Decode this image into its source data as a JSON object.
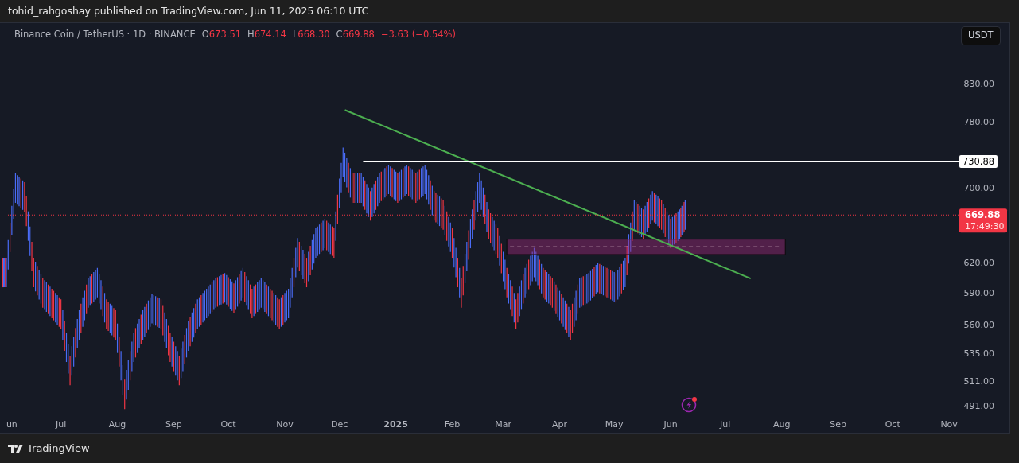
{
  "header": {
    "text": "tohid_rahgoshay published on TradingView.com, Jun 11, 2025 06:10 UTC"
  },
  "legend": {
    "symbol": "Binance Coin / TetherUS · 1D · BINANCE",
    "ohlc": [
      {
        "key": "O",
        "value": "673.51"
      },
      {
        "key": "H",
        "value": "674.14"
      },
      {
        "key": "L",
        "value": "668.30"
      },
      {
        "key": "C",
        "value": "669.88"
      }
    ],
    "change": "−3.63 (−0.54%)"
  },
  "currency_button": "USDT",
  "chart": {
    "price_axis": [
      "830.00",
      "780.00",
      "700.00",
      "620.00",
      "590.00",
      "560.00",
      "535.00",
      "511.00",
      "491.00"
    ],
    "time_axis": [
      {
        "label": "un",
        "kind": "month"
      },
      {
        "label": "Jul",
        "kind": "month"
      },
      {
        "label": "Aug",
        "kind": "month"
      },
      {
        "label": "Sep",
        "kind": "month"
      },
      {
        "label": "Oct",
        "kind": "month"
      },
      {
        "label": "Nov",
        "kind": "month"
      },
      {
        "label": "Dec",
        "kind": "month"
      },
      {
        "label": "2025",
        "kind": "year"
      },
      {
        "label": "Feb",
        "kind": "month"
      },
      {
        "label": "Mar",
        "kind": "month"
      },
      {
        "label": "Apr",
        "kind": "month"
      },
      {
        "label": "May",
        "kind": "month"
      },
      {
        "label": "Jun",
        "kind": "month"
      },
      {
        "label": "Jul",
        "kind": "month"
      },
      {
        "label": "Aug",
        "kind": "month"
      },
      {
        "label": "Sep",
        "kind": "month"
      },
      {
        "label": "Oct",
        "kind": "month"
      },
      {
        "label": "Nov",
        "kind": "month"
      }
    ],
    "level_label": "730.88",
    "price_label": "669.88",
    "countdown": "17:49:30"
  },
  "footer": {
    "brand": "TradingView"
  }
}
